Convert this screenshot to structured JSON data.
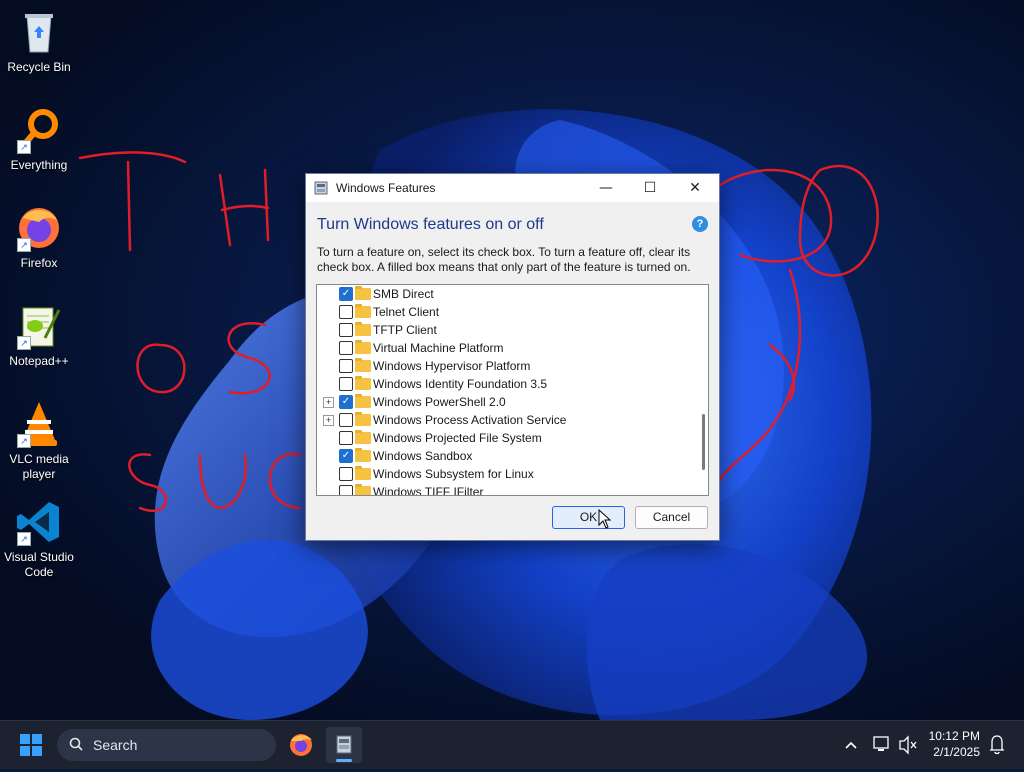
{
  "desktop": {
    "icons": [
      {
        "label": "Recycle Bin",
        "icon": "recycle-bin-icon"
      },
      {
        "label": "Everything",
        "icon": "everything-search-icon"
      },
      {
        "label": "Firefox",
        "icon": "firefox-icon"
      },
      {
        "label": "Notepad++",
        "icon": "notepad-plus-plus-icon"
      },
      {
        "label_line1": "VLC media",
        "label_line2": "player",
        "icon": "vlc-icon"
      },
      {
        "label_line1": "Visual Studio",
        "label_line2": "Code",
        "icon": "vscode-icon"
      }
    ]
  },
  "dialog": {
    "title": "Windows Features",
    "heading": "Turn Windows features on or off",
    "help_glyph": "?",
    "description": "To turn a feature on, select its check box. To turn a feature off, clear its check box. A filled box means that only part of the feature is turned on.",
    "features": [
      {
        "label": "SMB Direct",
        "checked": true,
        "expandable": false
      },
      {
        "label": "Telnet Client",
        "checked": false,
        "expandable": false
      },
      {
        "label": "TFTP Client",
        "checked": false,
        "expandable": false
      },
      {
        "label": "Virtual Machine Platform",
        "checked": false,
        "expandable": false
      },
      {
        "label": "Windows Hypervisor Platform",
        "checked": false,
        "expandable": false
      },
      {
        "label": "Windows Identity Foundation 3.5",
        "checked": false,
        "expandable": false
      },
      {
        "label": "Windows PowerShell 2.0",
        "checked": true,
        "expandable": true
      },
      {
        "label": "Windows Process Activation Service",
        "checked": false,
        "expandable": true
      },
      {
        "label": "Windows Projected File System",
        "checked": false,
        "expandable": false
      },
      {
        "label": "Windows Sandbox",
        "checked": true,
        "expandable": false
      },
      {
        "label": "Windows Subsystem for Linux",
        "checked": false,
        "expandable": false
      },
      {
        "label": "Windows TIFF IFilter",
        "checked": false,
        "expandable": false
      }
    ],
    "ok_label": "OK",
    "cancel_label": "Cancel"
  },
  "taskbar": {
    "search_placeholder": "Search",
    "time": "10:12 PM",
    "date": "2/1/2025",
    "apps": [
      "firefox-icon",
      "windows-features-icon"
    ]
  },
  "colors": {
    "accent": "#1f6fd1",
    "heading": "#1e3a8a",
    "scribble": "#e11d2a"
  }
}
